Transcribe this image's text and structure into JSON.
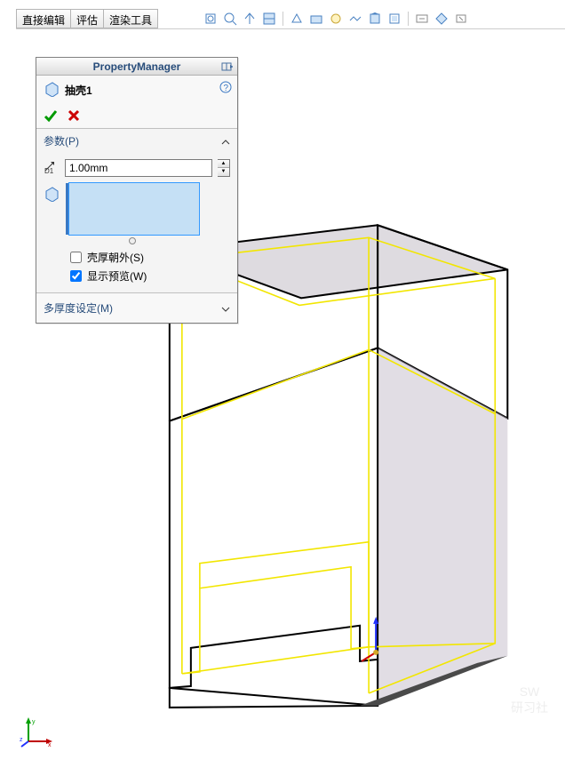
{
  "tabs": {
    "direct_edit": "直接编辑",
    "evaluate": "评估",
    "render_tools": "渲染工具"
  },
  "toolbar_icons": [
    "zoom-fit-icon",
    "zoom-area-icon",
    "prev-view-icon",
    "section-icon",
    "view-orient-icon",
    "display-style-icon",
    "hide-show-icon",
    "edit-appearance-icon",
    "apply-scene-icon",
    "view-settings-icon",
    "expand-icon",
    "shaded-icon",
    "close-panel-icon"
  ],
  "property_manager": {
    "title": "PropertyManager",
    "feature_name": "抽壳1",
    "sections": {
      "parameters": {
        "title": "参数(P)",
        "thickness": "1.00mm",
        "shell_outward": {
          "label": "壳厚朝外(S)",
          "checked": false
        },
        "show_preview": {
          "label": "显示预览(W)",
          "checked": true
        }
      },
      "multi_thickness": {
        "title": "多厚度设定(M)"
      }
    }
  },
  "watermark": {
    "line1": "SW",
    "line2": "研习社"
  }
}
